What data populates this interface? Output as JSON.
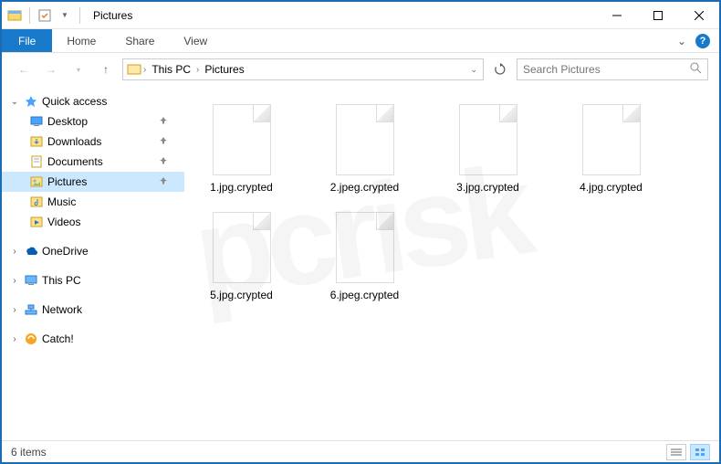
{
  "window": {
    "title": "Pictures"
  },
  "ribbon": {
    "file": "File",
    "tabs": [
      "Home",
      "Share",
      "View"
    ]
  },
  "breadcrumb": {
    "items": [
      "This PC",
      "Pictures"
    ]
  },
  "search": {
    "placeholder": "Search Pictures"
  },
  "sidebar": {
    "quick_access": {
      "label": "Quick access",
      "children": [
        {
          "label": "Desktop",
          "icon": "desktop",
          "pinned": true
        },
        {
          "label": "Downloads",
          "icon": "downloads",
          "pinned": true
        },
        {
          "label": "Documents",
          "icon": "documents",
          "pinned": true
        },
        {
          "label": "Pictures",
          "icon": "pictures",
          "pinned": true,
          "selected": true
        },
        {
          "label": "Music",
          "icon": "music",
          "pinned": false
        },
        {
          "label": "Videos",
          "icon": "videos",
          "pinned": false
        }
      ]
    },
    "roots": [
      {
        "label": "OneDrive",
        "icon": "onedrive"
      },
      {
        "label": "This PC",
        "icon": "thispc"
      },
      {
        "label": "Network",
        "icon": "network"
      },
      {
        "label": "Catch!",
        "icon": "catch"
      }
    ]
  },
  "files": [
    {
      "name": "1.jpg.crypted"
    },
    {
      "name": "2.jpeg.crypted"
    },
    {
      "name": "3.jpg.crypted"
    },
    {
      "name": "4.jpg.crypted"
    },
    {
      "name": "5.jpg.crypted"
    },
    {
      "name": "6.jpeg.crypted"
    }
  ],
  "statusbar": {
    "text": "6 items"
  }
}
